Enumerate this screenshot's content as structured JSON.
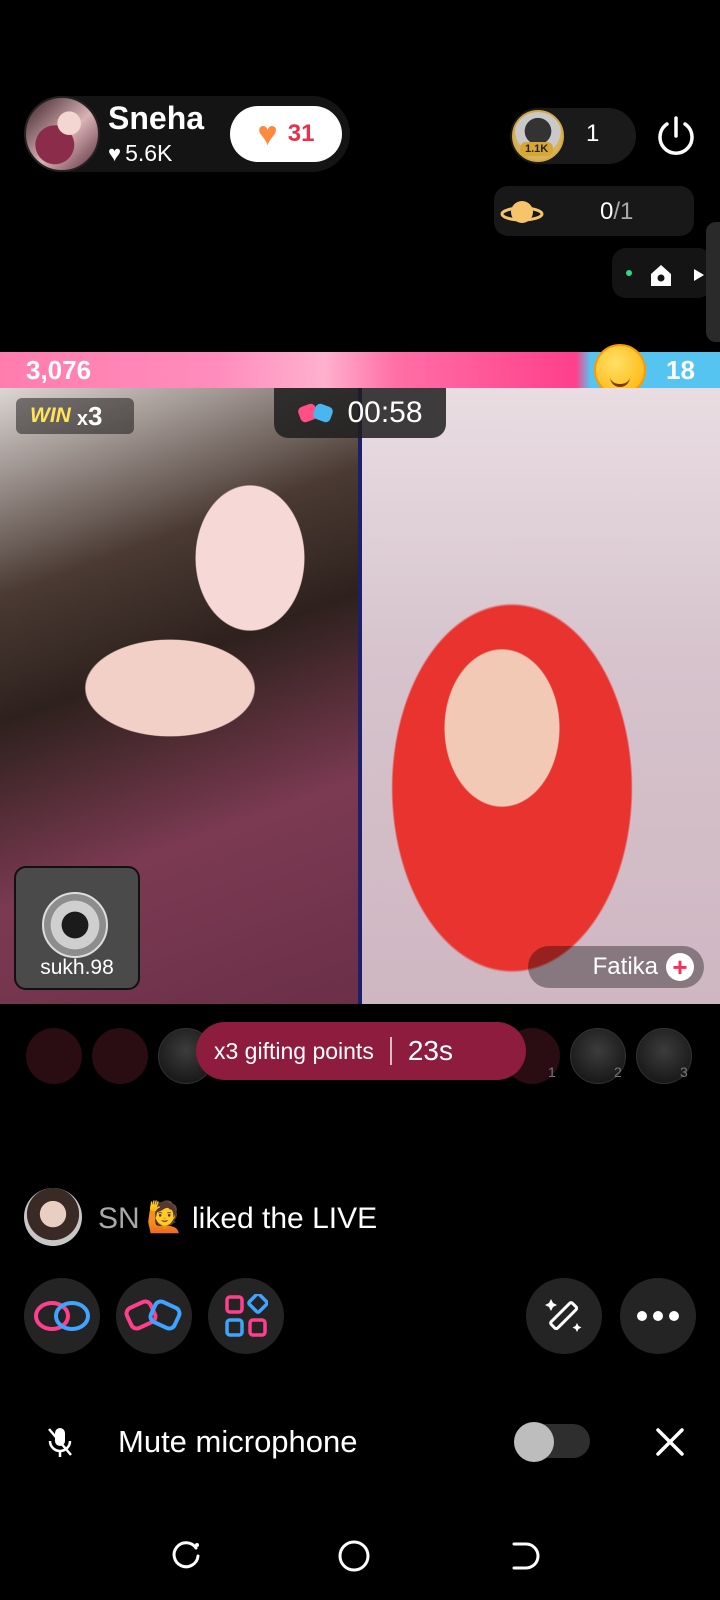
{
  "host": {
    "name": "Sneha",
    "likes": "5.6K",
    "gift_count": "31",
    "avatar_icon": "host-avatar"
  },
  "viewers": {
    "badge": "1.1K",
    "count": "1"
  },
  "planet": {
    "current": "0",
    "total": "/1"
  },
  "battle": {
    "left_score": "3,076",
    "right_score": "18",
    "win_label": "WIN",
    "win_mult_x": "x",
    "win_mult_num": "3",
    "timer": "00:58"
  },
  "guest": {
    "name": "sukh.98"
  },
  "opponent": {
    "name": "Fatika"
  },
  "gifting": {
    "label": "x3 gifting points",
    "countdown": "23s"
  },
  "seat_numbers": [
    "1",
    "2",
    "3"
  ],
  "comment": {
    "user": "SN",
    "emoji": "🙋",
    "text": "liked the LIVE"
  },
  "controls": {
    "mute_label": "Mute microphone",
    "mute_on": false
  },
  "colors": {
    "accent_pink": "#ff3f8c",
    "accent_blue": "#56c4f0",
    "gifting_bg": "#8e1c3e"
  }
}
